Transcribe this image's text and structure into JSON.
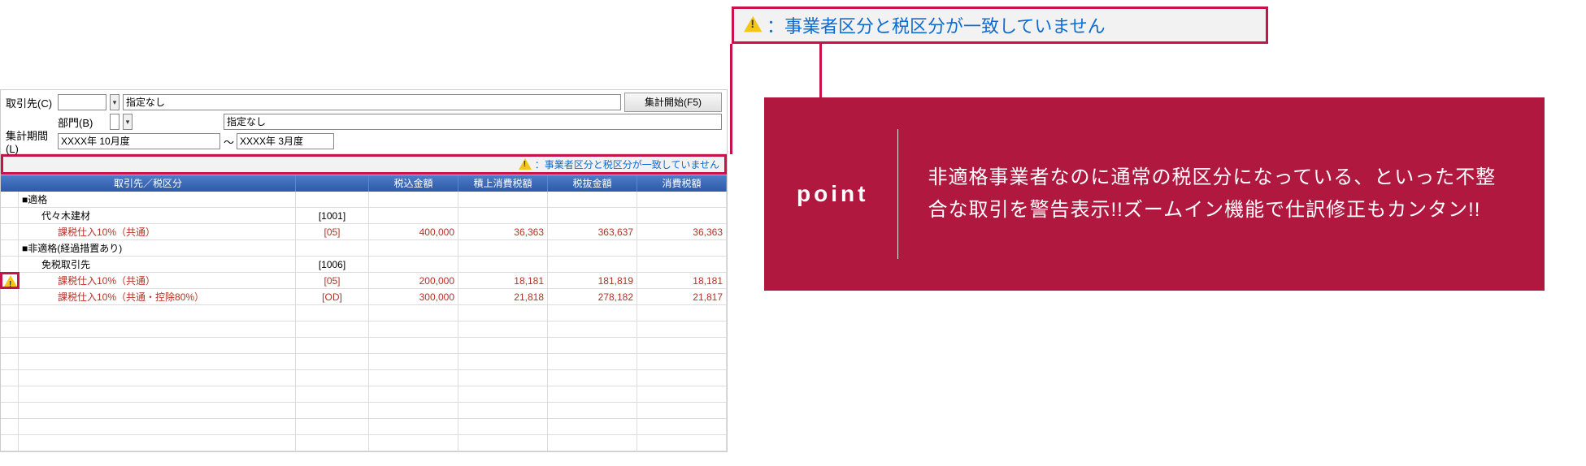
{
  "top_warning": {
    "text": "：事業者区分と税区分が一致していません"
  },
  "filters": {
    "torihikisaki_label": "取引先(C)",
    "bumon_label": "部門(B)",
    "shukei_kikan_label": "集計期間(L)",
    "torihikisaki_value": "指定なし",
    "bumon_value": "指定なし",
    "period_from": "XXXX年 10月度",
    "period_sep": "～",
    "period_to": "XXXX年 3月度",
    "run_button": "集計開始(F5)"
  },
  "inline_warning": "：事業者区分と税区分が一致していません",
  "table": {
    "headers": {
      "c0": "",
      "c1": "取引先／税区分",
      "c2": "",
      "c3": "税込金額",
      "c4": "積上消費税額",
      "c5": "税抜金額",
      "c6": "消費税額"
    },
    "rows": [
      {
        "type": "section",
        "label": "■適格"
      },
      {
        "type": "client",
        "label": "代々木建材",
        "code": "[1001]"
      },
      {
        "type": "tax",
        "label": "課税仕入10%（共通）",
        "code": "[05]",
        "zeikomi": "400,000",
        "tsumiage": "36,363",
        "zeinuki": "363,637",
        "shouhi": "36,363",
        "warn": false
      },
      {
        "type": "section",
        "label": "■非適格(経過措置あり)"
      },
      {
        "type": "client",
        "label": "免税取引先",
        "code": "[1006]"
      },
      {
        "type": "tax",
        "label": "課税仕入10%（共通）",
        "code": "[05]",
        "zeikomi": "200,000",
        "tsumiage": "18,181",
        "zeinuki": "181,819",
        "shouhi": "18,181",
        "warn": true
      },
      {
        "type": "tax",
        "label": "課税仕入10%（共通・控除80%）",
        "code": "[OD]",
        "zeikomi": "300,000",
        "tsumiage": "21,818",
        "zeinuki": "278,182",
        "shouhi": "21,817",
        "warn": false
      },
      {
        "type": "empty"
      },
      {
        "type": "empty"
      },
      {
        "type": "empty"
      },
      {
        "type": "empty"
      },
      {
        "type": "empty"
      },
      {
        "type": "empty"
      },
      {
        "type": "empty"
      },
      {
        "type": "empty"
      },
      {
        "type": "empty"
      }
    ]
  },
  "point": {
    "label": "point",
    "text": "非適格事業者なのに通常の税区分になっている、といった不整合な取引を警告表示!!ズームイン機能で仕訳修正もカンタン!!"
  }
}
